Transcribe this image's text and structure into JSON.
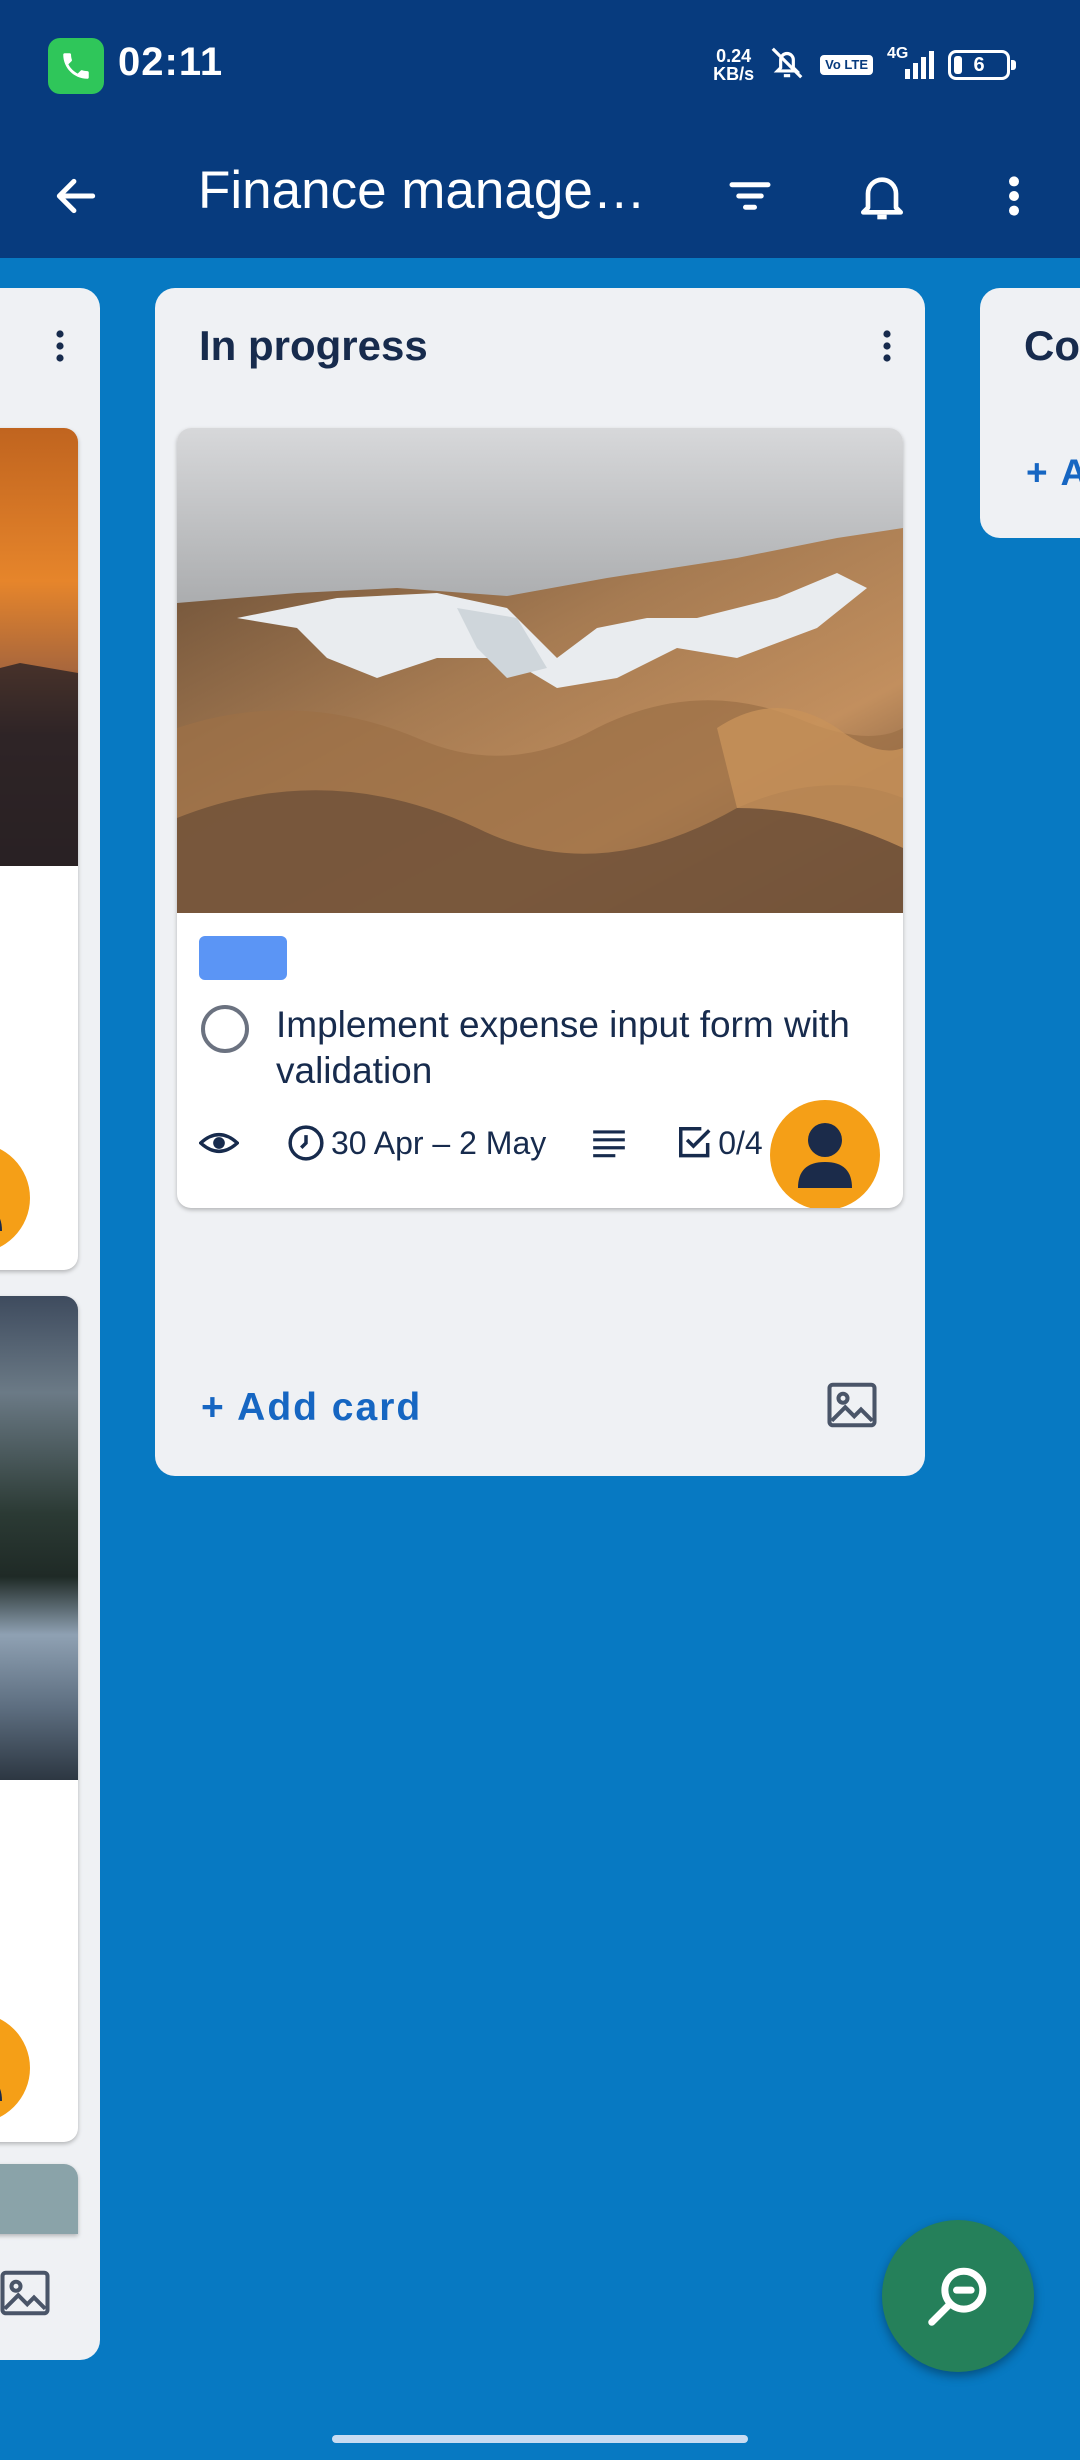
{
  "status_bar": {
    "time": "02:11",
    "net_speed_value": "0.24",
    "net_speed_unit": "KB/s",
    "volte": "Vo LTE",
    "network": "4G",
    "battery": "6"
  },
  "app_bar": {
    "title": "Finance manage…"
  },
  "lists": {
    "left_partial": {},
    "in_progress": {
      "title": "In progress",
      "card": {
        "label_color": "#5b95f5",
        "title": "Implement expense input form with validation",
        "dates": "30 Apr – 2 May",
        "checklist": "0/4"
      },
      "add_card": "+ Add card"
    },
    "right_partial": {
      "title": "Co",
      "add_card": "+ A"
    }
  },
  "colors": {
    "board_bg": "#0779c2",
    "app_bar": "#073b7e",
    "avatar": "#f59f17",
    "fab": "#25805a",
    "accent_link": "#1666c2"
  }
}
